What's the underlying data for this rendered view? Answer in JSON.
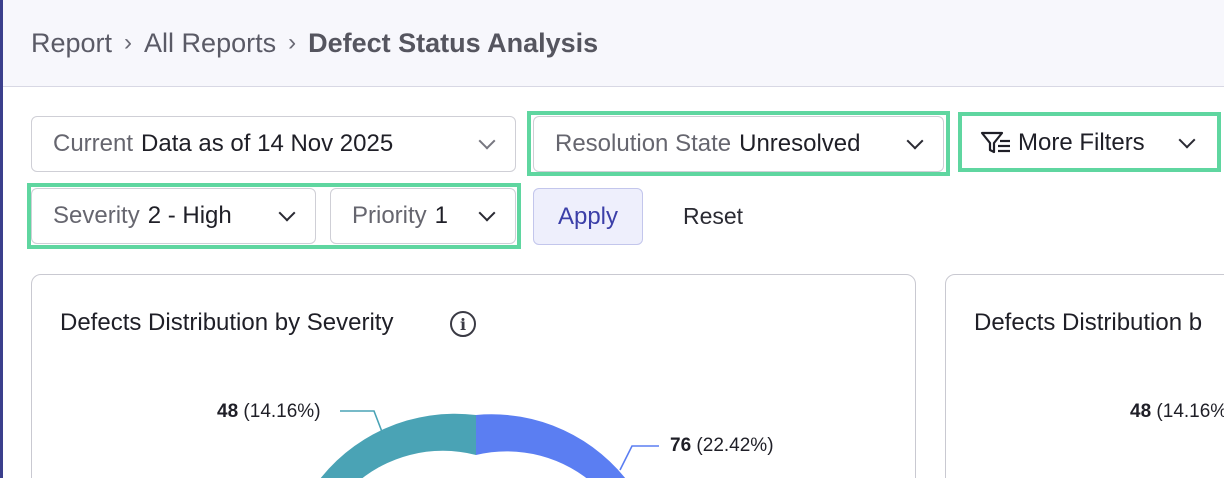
{
  "breadcrumb": {
    "items": [
      "Report",
      "All Reports"
    ],
    "current": "Defect Status Analysis",
    "separator": "›"
  },
  "filters": {
    "date": {
      "label": "Current",
      "value": "Data as of 14 Nov 2025"
    },
    "resolution": {
      "label": "Resolution State",
      "value": "Unresolved"
    },
    "more_filters": "More Filters",
    "severity": {
      "label": "Severity",
      "value": "2 - High"
    },
    "priority": {
      "label": "Priority",
      "value": "1"
    },
    "apply": "Apply",
    "reset": "Reset"
  },
  "cards": [
    {
      "title": "Defects Distribution by Severity",
      "labels": [
        {
          "count": "48",
          "pct": "(14.16%)"
        },
        {
          "count": "76",
          "pct": "(22.42%)"
        }
      ]
    },
    {
      "title": "Defects Distribution b",
      "labels": [
        {
          "count": "48",
          "pct": "(14.16%"
        }
      ]
    }
  ],
  "colors": {
    "teal": "#4aa3b5",
    "blue": "#5b7ef2",
    "highlight": "#5fd6a0",
    "accent": "#3b3fa8"
  }
}
